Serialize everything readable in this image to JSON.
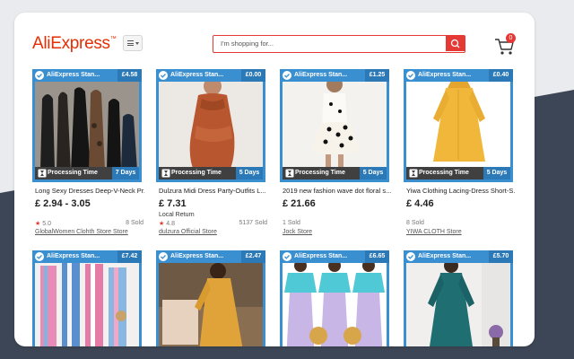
{
  "header": {
    "logo": "AliExpress",
    "logo_tm": "™",
    "search_placeholder": "I'm shopping for...",
    "cart_count": "0"
  },
  "products": [
    {
      "badge": "AliExpress Stan...",
      "price_tag": "£4.58",
      "processing_label": "Processing Time",
      "days": "7 Days",
      "title": "Long Sexy Dresses Deep-V-Neck Pr...",
      "price": "£ 2.94 - 3.05",
      "note": "",
      "rating": "5.0",
      "sold": "8 Sold",
      "store": "GlobalWomen Clohth Store Store"
    },
    {
      "badge": "AliExpress Stan...",
      "price_tag": "£0.00",
      "processing_label": "Processing Time",
      "days": "5 Days",
      "title": "Dulzura Midi Dress Party-Outfits L...",
      "price": "£ 7.31",
      "note": "Local Return",
      "rating": "4.8",
      "sold": "5137 Sold",
      "store": "dulzura Official Store"
    },
    {
      "badge": "AliExpress Stan...",
      "price_tag": "£1.25",
      "processing_label": "Processing Time",
      "days": "5 Days",
      "title": "2019 new fashion wave dot floral s...",
      "price": "£ 21.66",
      "note": "",
      "rating": "",
      "sold": "1 Sold",
      "store": "Jock Store"
    },
    {
      "badge": "AliExpress Stan...",
      "price_tag": "£0.40",
      "processing_label": "Processing Time",
      "days": "5 Days",
      "title": "Yiwa Clothing Lacing-Dress Short-S...",
      "price": "£ 4.46",
      "note": "",
      "rating": "",
      "sold": "8 Sold",
      "store": "YIWA CLOTH Store"
    },
    {
      "badge": "AliExpress Stan...",
      "price_tag": "£7.42"
    },
    {
      "badge": "AliExpress Stan...",
      "price_tag": "£2.47"
    },
    {
      "badge": "AliExpress Stan...",
      "price_tag": "£6.65"
    },
    {
      "badge": "AliExpress Stan...",
      "price_tag": "£5.70"
    }
  ],
  "colors": {
    "brand": "#e62e04",
    "accent_blue": "#3a8fd0",
    "search_red": "#e53935"
  }
}
